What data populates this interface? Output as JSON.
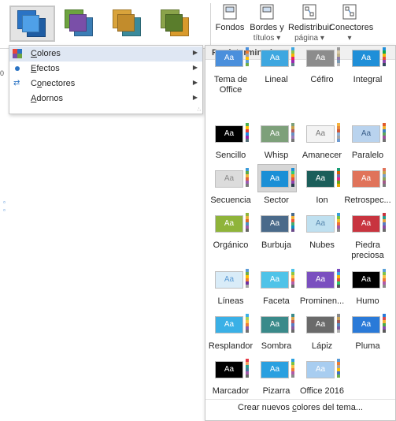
{
  "ribbon": {
    "variants": [
      {
        "name": "variant-1",
        "colors": [
          "#2a73c4",
          "#1f5da3",
          "#4fa0e8"
        ],
        "selected": true
      },
      {
        "name": "variant-2",
        "colors": [
          "#6da33f",
          "#3a7db5",
          "#7a4fa8"
        ],
        "selected": false
      },
      {
        "name": "variant-3",
        "colors": [
          "#d9a33b",
          "#3a8a9b",
          "#c28c2c"
        ],
        "selected": false
      },
      {
        "name": "variant-4",
        "colors": [
          "#8aa34a",
          "#d99a2c",
          "#5a7d2c"
        ],
        "selected": false
      }
    ],
    "buttons": [
      {
        "line1": "Fondos",
        "line2": "",
        "icon": "background-icon"
      },
      {
        "line1": "Bordes y",
        "line2": "títulos ▾",
        "icon": "borders-titles-icon"
      },
      {
        "line1": "Redistribuir",
        "line2": "página ▾",
        "icon": "redistribute-page-icon"
      },
      {
        "line1": "Conectores",
        "line2": "▾",
        "icon": "connectors-icon"
      }
    ]
  },
  "menu": {
    "items": [
      {
        "label": "Colores",
        "accel": "C",
        "icon": "colors-icon",
        "hover": true
      },
      {
        "label": "Efectos",
        "accel": "E",
        "icon": "effects-icon",
        "hover": false
      },
      {
        "label": "Conectores",
        "accel": "o",
        "icon": "connectors-icon",
        "hover": false
      },
      {
        "label": "Adornos",
        "accel": "A",
        "icon": "",
        "hover": false
      }
    ]
  },
  "gallery": {
    "header": "Predeterminados",
    "thumb_text": "Aa",
    "themes": [
      {
        "name": "Tema de Office",
        "bg": "#4a8fdc",
        "fg": "#ffffff",
        "strip": [
          "#4a8fdc",
          "#ee7b30",
          "#a5a5a5",
          "#ffc000",
          "#5b9bd5",
          "#70ad47"
        ]
      },
      {
        "name": "Lineal",
        "bg": "#3ea7e0",
        "fg": "#ffffff",
        "strip": [
          "#3ea7e0",
          "#8bc34a",
          "#f4b400",
          "#e91e63",
          "#9c27b0",
          "#607d8b"
        ]
      },
      {
        "name": "Céfiro",
        "bg": "#8c8c8c",
        "fg": "#ffffff",
        "strip": [
          "#9e9e9e",
          "#d7c9a8",
          "#c0b28a",
          "#8e7fa8",
          "#7d9bb5",
          "#bdbdbd"
        ]
      },
      {
        "name": "Integral",
        "bg": "#1f8fd8",
        "fg": "#ffffff",
        "strip": [
          "#1f8fd8",
          "#0ba94e",
          "#f2b705",
          "#e74c3c",
          "#8e44ad",
          "#34495e"
        ]
      },
      {
        "name": "Sencillo",
        "bg": "#000000",
        "fg": "#ffffff",
        "strip": [
          "#4caf50",
          "#ffc107",
          "#e53935",
          "#1e88e5",
          "#8e24aa",
          "#546e7a"
        ]
      },
      {
        "name": "Whisp",
        "bg": "#7da07a",
        "fg": "#ffffff",
        "strip": [
          "#7da07a",
          "#c9a04a",
          "#b85c5c",
          "#6a8fc2",
          "#9b7bb8",
          "#777777"
        ]
      },
      {
        "name": "Amanecer",
        "bg": "#f3f3f3",
        "fg": "#7a7a7a",
        "strip": [
          "#f5b440",
          "#e68a3c",
          "#d05a3a",
          "#8fb4d9",
          "#a5a5a5",
          "#6f9bd1"
        ]
      },
      {
        "name": "Paralelo",
        "bg": "#b9d3ee",
        "fg": "#3a5f8a",
        "strip": [
          "#e15a2b",
          "#f0b330",
          "#3c7fc1",
          "#5ba35b",
          "#9c4f9c",
          "#707070"
        ]
      },
      {
        "name": "Secuencia",
        "bg": "#dcdcdc",
        "fg": "#8a8a8a",
        "strip": [
          "#3b9bd9",
          "#5aa84a",
          "#f0b83a",
          "#e0633a",
          "#9a5bb0",
          "#7a7a7a"
        ]
      },
      {
        "name": "Sector",
        "bg": "#1a8fd6",
        "fg": "#ffffff",
        "strip": [
          "#1a8fd6",
          "#2ecc71",
          "#f39c12",
          "#e74c3c",
          "#8e44ad",
          "#2c3e50"
        ],
        "selected": true
      },
      {
        "name": "Ion",
        "bg": "#1b5e5a",
        "fg": "#ffffff",
        "strip": [
          "#1b9e77",
          "#d95f02",
          "#7570b3",
          "#e7298a",
          "#66a61e",
          "#e6ab02"
        ]
      },
      {
        "name": "Retrospec...",
        "bg": "#e0735a",
        "fg": "#ffffff",
        "strip": [
          "#e0735a",
          "#c9a24a",
          "#7a9fc2",
          "#8aa35a",
          "#a05a8a",
          "#7a7a7a"
        ]
      },
      {
        "name": "Orgánico",
        "bg": "#8fb43a",
        "fg": "#ffffff",
        "strip": [
          "#8fb43a",
          "#e6b13a",
          "#d9682a",
          "#4a8fc2",
          "#9a5aa5",
          "#666666"
        ]
      },
      {
        "name": "Burbuja",
        "bg": "#4a6a8a",
        "fg": "#ffffff",
        "strip": [
          "#4a6a8a",
          "#f2b134",
          "#ed553b",
          "#47ab6c",
          "#0c8fc3",
          "#6a4a8a"
        ]
      },
      {
        "name": "Nubes",
        "bg": "#bfe0f0",
        "fg": "#5a8ab0",
        "strip": [
          "#3aa0d9",
          "#7bc142",
          "#f2c12e",
          "#ef6f3c",
          "#a05aa8",
          "#8c8c8c"
        ]
      },
      {
        "name": "Piedra preciosa",
        "bg": "#c8343f",
        "fg": "#ffffff",
        "strip": [
          "#c8343f",
          "#2a9a8a",
          "#e8a33a",
          "#5a7ac2",
          "#8a4aa0",
          "#6a6a6a"
        ]
      },
      {
        "name": "Líneas",
        "bg": "#d9ecf8",
        "fg": "#5b9bd5",
        "strip": [
          "#5b9bd5",
          "#70ad47",
          "#ffc000",
          "#ed7d31",
          "#7030a0",
          "#a5a5a5"
        ]
      },
      {
        "name": "Faceta",
        "bg": "#4fc3e8",
        "fg": "#ffffff",
        "strip": [
          "#4fc3e8",
          "#90c53f",
          "#f7c23e",
          "#f26a3f",
          "#b35fa8",
          "#6a6a6a"
        ]
      },
      {
        "name": "Prominen...",
        "bg": "#7a4fbf",
        "fg": "#ffffff",
        "strip": [
          "#7a4fbf",
          "#3ea7e0",
          "#f2b705",
          "#e74c3c",
          "#2ecc71",
          "#555555"
        ]
      },
      {
        "name": "Humo",
        "bg": "#000000",
        "fg": "#ffffff",
        "strip": [
          "#5aa0d8",
          "#7ec14a",
          "#f5c342",
          "#ef7a38",
          "#b05aa8",
          "#8a8a8a"
        ]
      },
      {
        "name": "Resplandor",
        "bg": "#3ab0e6",
        "fg": "#ffffff",
        "strip": [
          "#3ab0e6",
          "#a6d25a",
          "#f5c342",
          "#ef7a38",
          "#8a5aa8",
          "#707070"
        ]
      },
      {
        "name": "Sombra",
        "bg": "#3a8a8a",
        "fg": "#ffffff",
        "strip": [
          "#3a8a8a",
          "#d9a34a",
          "#c25a5a",
          "#5a7ac2",
          "#8a5aa0",
          "#6a6a6a"
        ]
      },
      {
        "name": "Lápiz",
        "bg": "#6a6a6a",
        "fg": "#ffffff",
        "strip": [
          "#8a8a8a",
          "#c9a55a",
          "#a05a5a",
          "#5a8ac2",
          "#7a5aa0",
          "#b0b0b0"
        ]
      },
      {
        "name": "Pluma",
        "bg": "#2a7ad8",
        "fg": "#ffffff",
        "strip": [
          "#2a7ad8",
          "#d94a4a",
          "#f5b334",
          "#4aa84a",
          "#8a4ab0",
          "#5a5a5a"
        ]
      },
      {
        "name": "Marcador",
        "bg": "#000000",
        "fg": "#ffffff",
        "strip": [
          "#e63946",
          "#f4a261",
          "#2a9d8f",
          "#457b9d",
          "#a05aa8",
          "#6a6a6a"
        ]
      },
      {
        "name": "Pizarra",
        "bg": "#2aa0e0",
        "fg": "#ffffff",
        "strip": [
          "#2aa0e0",
          "#7cc142",
          "#f5c342",
          "#ef7a38",
          "#b05aa8",
          "#8a8a8a"
        ]
      },
      {
        "name": "Office 2016",
        "bg": "#a8cdf0",
        "fg": "#ffffff",
        "strip": [
          "#5b9bd5",
          "#ed7d31",
          "#a5a5a5",
          "#ffc000",
          "#4472c4",
          "#70ad47"
        ]
      }
    ],
    "footer": {
      "before": "Crear nuevos ",
      "accel": "c",
      "after": "olores del tema..."
    }
  }
}
